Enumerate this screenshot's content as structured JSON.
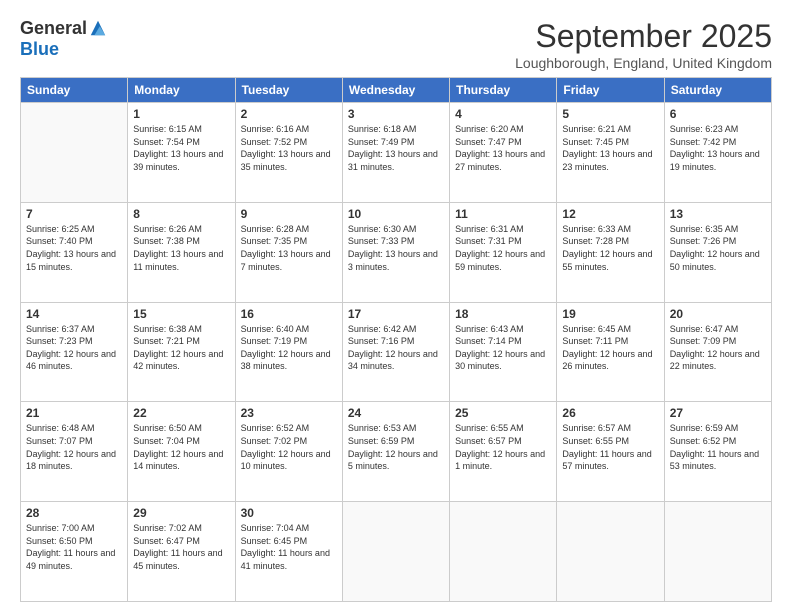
{
  "logo": {
    "general": "General",
    "blue": "Blue"
  },
  "header": {
    "month": "September 2025",
    "location": "Loughborough, England, United Kingdom"
  },
  "days_of_week": [
    "Sunday",
    "Monday",
    "Tuesday",
    "Wednesday",
    "Thursday",
    "Friday",
    "Saturday"
  ],
  "weeks": [
    [
      {
        "day": "",
        "info": ""
      },
      {
        "day": "1",
        "info": "Sunrise: 6:15 AM\nSunset: 7:54 PM\nDaylight: 13 hours\nand 39 minutes."
      },
      {
        "day": "2",
        "info": "Sunrise: 6:16 AM\nSunset: 7:52 PM\nDaylight: 13 hours\nand 35 minutes."
      },
      {
        "day": "3",
        "info": "Sunrise: 6:18 AM\nSunset: 7:49 PM\nDaylight: 13 hours\nand 31 minutes."
      },
      {
        "day": "4",
        "info": "Sunrise: 6:20 AM\nSunset: 7:47 PM\nDaylight: 13 hours\nand 27 minutes."
      },
      {
        "day": "5",
        "info": "Sunrise: 6:21 AM\nSunset: 7:45 PM\nDaylight: 13 hours\nand 23 minutes."
      },
      {
        "day": "6",
        "info": "Sunrise: 6:23 AM\nSunset: 7:42 PM\nDaylight: 13 hours\nand 19 minutes."
      }
    ],
    [
      {
        "day": "7",
        "info": "Sunrise: 6:25 AM\nSunset: 7:40 PM\nDaylight: 13 hours\nand 15 minutes."
      },
      {
        "day": "8",
        "info": "Sunrise: 6:26 AM\nSunset: 7:38 PM\nDaylight: 13 hours\nand 11 minutes."
      },
      {
        "day": "9",
        "info": "Sunrise: 6:28 AM\nSunset: 7:35 PM\nDaylight: 13 hours\nand 7 minutes."
      },
      {
        "day": "10",
        "info": "Sunrise: 6:30 AM\nSunset: 7:33 PM\nDaylight: 13 hours\nand 3 minutes."
      },
      {
        "day": "11",
        "info": "Sunrise: 6:31 AM\nSunset: 7:31 PM\nDaylight: 12 hours\nand 59 minutes."
      },
      {
        "day": "12",
        "info": "Sunrise: 6:33 AM\nSunset: 7:28 PM\nDaylight: 12 hours\nand 55 minutes."
      },
      {
        "day": "13",
        "info": "Sunrise: 6:35 AM\nSunset: 7:26 PM\nDaylight: 12 hours\nand 50 minutes."
      }
    ],
    [
      {
        "day": "14",
        "info": "Sunrise: 6:37 AM\nSunset: 7:23 PM\nDaylight: 12 hours\nand 46 minutes."
      },
      {
        "day": "15",
        "info": "Sunrise: 6:38 AM\nSunset: 7:21 PM\nDaylight: 12 hours\nand 42 minutes."
      },
      {
        "day": "16",
        "info": "Sunrise: 6:40 AM\nSunset: 7:19 PM\nDaylight: 12 hours\nand 38 minutes."
      },
      {
        "day": "17",
        "info": "Sunrise: 6:42 AM\nSunset: 7:16 PM\nDaylight: 12 hours\nand 34 minutes."
      },
      {
        "day": "18",
        "info": "Sunrise: 6:43 AM\nSunset: 7:14 PM\nDaylight: 12 hours\nand 30 minutes."
      },
      {
        "day": "19",
        "info": "Sunrise: 6:45 AM\nSunset: 7:11 PM\nDaylight: 12 hours\nand 26 minutes."
      },
      {
        "day": "20",
        "info": "Sunrise: 6:47 AM\nSunset: 7:09 PM\nDaylight: 12 hours\nand 22 minutes."
      }
    ],
    [
      {
        "day": "21",
        "info": "Sunrise: 6:48 AM\nSunset: 7:07 PM\nDaylight: 12 hours\nand 18 minutes."
      },
      {
        "day": "22",
        "info": "Sunrise: 6:50 AM\nSunset: 7:04 PM\nDaylight: 12 hours\nand 14 minutes."
      },
      {
        "day": "23",
        "info": "Sunrise: 6:52 AM\nSunset: 7:02 PM\nDaylight: 12 hours\nand 10 minutes."
      },
      {
        "day": "24",
        "info": "Sunrise: 6:53 AM\nSunset: 6:59 PM\nDaylight: 12 hours\nand 5 minutes."
      },
      {
        "day": "25",
        "info": "Sunrise: 6:55 AM\nSunset: 6:57 PM\nDaylight: 12 hours\nand 1 minute."
      },
      {
        "day": "26",
        "info": "Sunrise: 6:57 AM\nSunset: 6:55 PM\nDaylight: 11 hours\nand 57 minutes."
      },
      {
        "day": "27",
        "info": "Sunrise: 6:59 AM\nSunset: 6:52 PM\nDaylight: 11 hours\nand 53 minutes."
      }
    ],
    [
      {
        "day": "28",
        "info": "Sunrise: 7:00 AM\nSunset: 6:50 PM\nDaylight: 11 hours\nand 49 minutes."
      },
      {
        "day": "29",
        "info": "Sunrise: 7:02 AM\nSunset: 6:47 PM\nDaylight: 11 hours\nand 45 minutes."
      },
      {
        "day": "30",
        "info": "Sunrise: 7:04 AM\nSunset: 6:45 PM\nDaylight: 11 hours\nand 41 minutes."
      },
      {
        "day": "",
        "info": ""
      },
      {
        "day": "",
        "info": ""
      },
      {
        "day": "",
        "info": ""
      },
      {
        "day": "",
        "info": ""
      }
    ]
  ]
}
